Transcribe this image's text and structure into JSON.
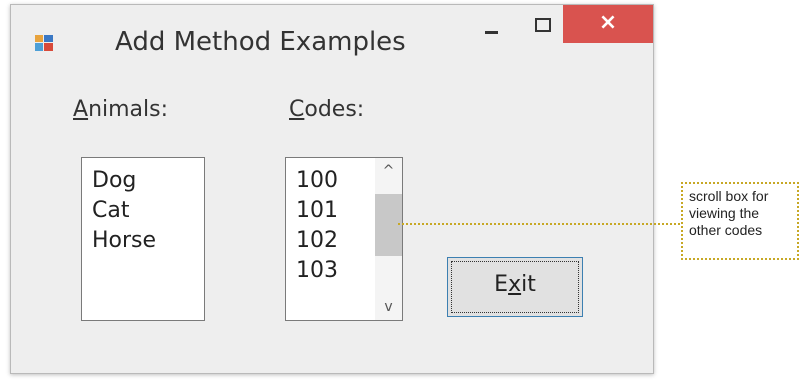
{
  "window": {
    "title": "Add Method Examples",
    "close_glyph": "×"
  },
  "animals": {
    "label_prefix": "",
    "label_mnemonic": "A",
    "label_rest": "nimals:",
    "items": [
      "Dog",
      "Cat",
      "Horse"
    ]
  },
  "codes": {
    "label_mnemonic": "C",
    "label_rest": "odes:",
    "items": [
      "100",
      "101",
      "102",
      "103"
    ],
    "scroll_up_glyph": "^",
    "scroll_down_glyph": "v"
  },
  "exit_button": {
    "label_prefix": "E",
    "label_mnemonic": "x",
    "label_rest": "it"
  },
  "callout": {
    "lines": [
      "scroll box for",
      "viewing the",
      "other codes"
    ]
  },
  "colors": {
    "close_button": "#d9534f",
    "callout_border": "#c7a825",
    "window_background": "#eeeeee"
  },
  "icons": {
    "app": "app-icon",
    "minimize": "minimize-icon",
    "maximize": "maximize-icon",
    "close": "close-icon"
  }
}
